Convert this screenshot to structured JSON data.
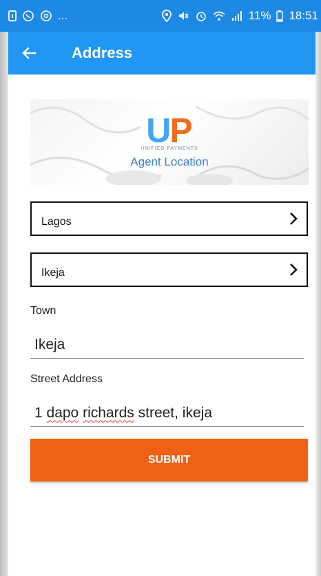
{
  "status_bar": {
    "left_dots": "...",
    "battery_percent": "11%",
    "time": "18:51"
  },
  "app_bar": {
    "title": "Address",
    "back_icon": "arrow-left-icon"
  },
  "banner": {
    "logo_letter_u": "U",
    "logo_letter_p": "P",
    "logo_subtitle": "UNIFIED PAYMENTS",
    "title": "Agent Location"
  },
  "state_select": {
    "value": "Lagos"
  },
  "lga_select": {
    "value": "Ikeja"
  },
  "town": {
    "label": "Town",
    "value": "Ikeja"
  },
  "street": {
    "label": "Street Address",
    "value_parts": [
      "1 ",
      "dapo",
      " ",
      "richards",
      " street, ikeja"
    ]
  },
  "submit": {
    "label": "SUBMIT"
  },
  "colors": {
    "status_bar": "#1e88e5",
    "app_bar": "#2196f3",
    "submit": "#ef6116",
    "logo_blue": "#42a5f5",
    "logo_orange": "#ef6c1f"
  }
}
